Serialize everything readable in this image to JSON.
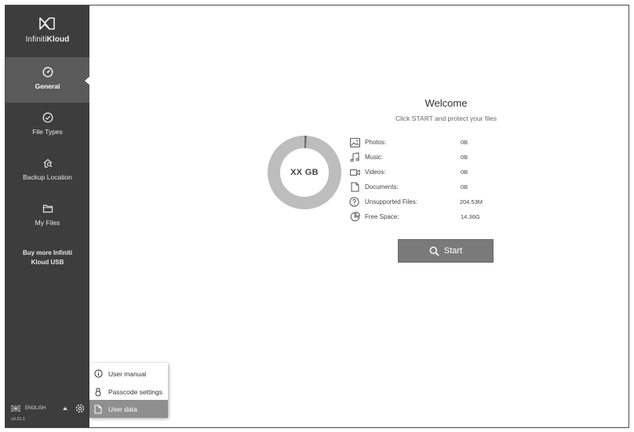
{
  "app": {
    "brand_light": "Infiniti",
    "brand_bold": "Kloud",
    "version": "v0.21.1"
  },
  "sidebar": {
    "items": [
      {
        "label": "General",
        "icon": "speedometer-icon",
        "active": true
      },
      {
        "label": "File Types",
        "icon": "check-circle-icon",
        "active": false
      },
      {
        "label": "Backup Location",
        "icon": "house-search-icon",
        "active": false
      },
      {
        "label": "My Files",
        "icon": "folder-icon",
        "active": false
      }
    ],
    "buy_more_line1": "Buy more Infiniti",
    "buy_more_line2": "Kloud USB",
    "language": "ENGLISH"
  },
  "popup_menu": {
    "items": [
      {
        "label": "User manual",
        "icon": "info-icon",
        "selected": false
      },
      {
        "label": "Passcode settings",
        "icon": "lock-icon",
        "selected": false
      },
      {
        "label": "User data",
        "icon": "document-icon",
        "selected": true
      }
    ]
  },
  "main": {
    "title": "Welcome",
    "subtitle": "Click START and protect your files",
    "donut_label": "XX GB",
    "donut_used_fraction": 0.01,
    "stats": [
      {
        "label": "Photos:",
        "value": "0B",
        "icon": "image-icon"
      },
      {
        "label": "Music:",
        "value": "0B",
        "icon": "music-note-icon"
      },
      {
        "label": "Videos:",
        "value": "0B",
        "icon": "video-camera-icon"
      },
      {
        "label": "Documents:",
        "value": "0B",
        "icon": "document-icon"
      },
      {
        "label": "Unsupported Files:",
        "value": "204.53M",
        "icon": "question-circle-icon"
      },
      {
        "label": "Free Space:",
        "value": "14.36G",
        "icon": "pie-chart-icon"
      }
    ],
    "start_label": "Start"
  },
  "colors": {
    "sidebar_bg": "#3d3d3d",
    "sidebar_active": "#5a5a5a",
    "donut_ring": "#bdbdbd",
    "button_bg": "#7a7a7a"
  }
}
